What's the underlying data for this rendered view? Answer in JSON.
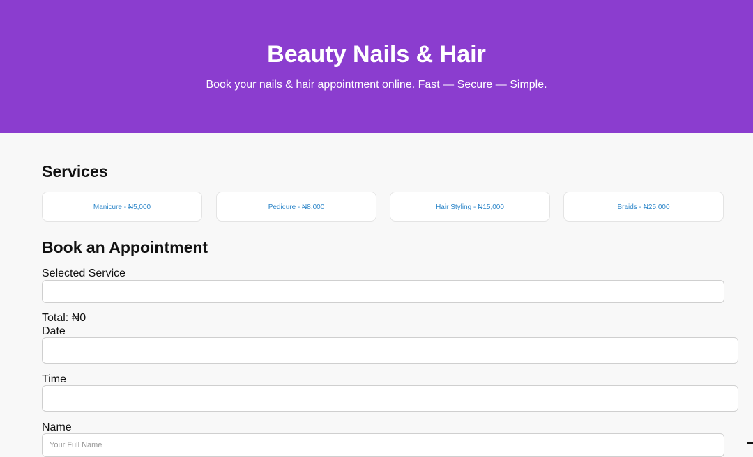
{
  "header": {
    "title": "Beauty Nails & Hair",
    "tagline": "Book your nails & hair appointment online. Fast — Secure — Simple."
  },
  "services": {
    "heading": "Services",
    "items": [
      {
        "label": "Manicure - ₦5,000"
      },
      {
        "label": "Pedicure - ₦8,000"
      },
      {
        "label": "Hair Styling - ₦15,000"
      },
      {
        "label": "Braids - ₦25,000"
      }
    ]
  },
  "booking": {
    "heading": "Book an Appointment",
    "selected_service_label": "Selected Service",
    "selected_service_value": "",
    "total_text": "Total: ₦0",
    "date_label": "Date",
    "date_value": "",
    "time_label": "Time",
    "time_value": "",
    "name_label": "Name",
    "name_placeholder": "Your Full Name"
  },
  "colors": {
    "brand": "#8b3dcf",
    "link": "#2d86c9",
    "background": "#f8f8f8"
  }
}
